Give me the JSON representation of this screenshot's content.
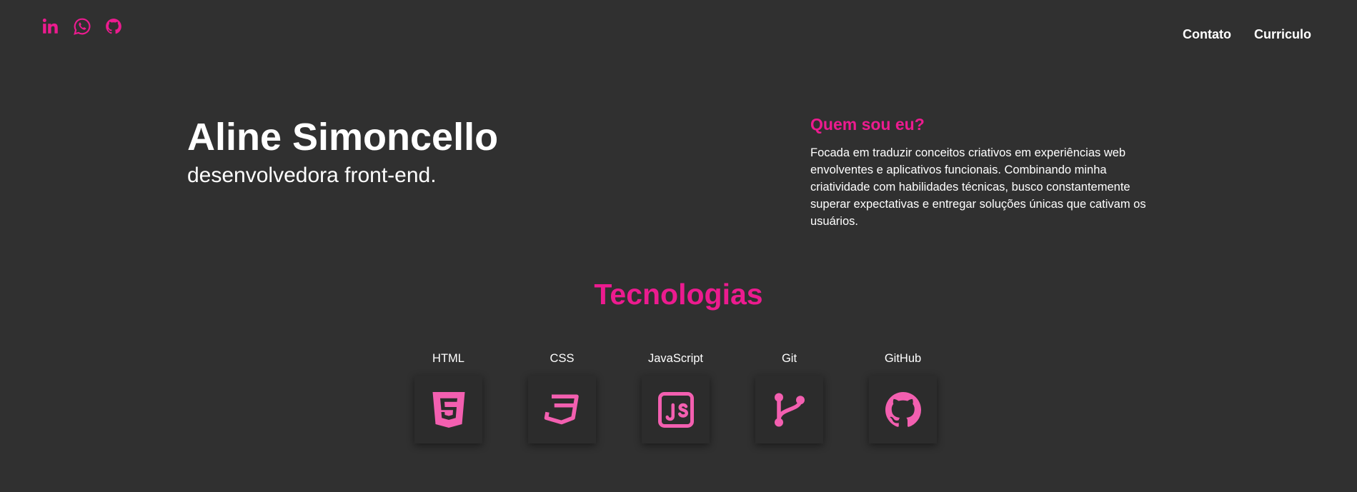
{
  "colors": {
    "accent": "#ec1b8f",
    "icon_pink": "#f35fb0",
    "background": "#303030",
    "text": "#ffffff"
  },
  "social": [
    {
      "icon": "linkedin-icon"
    },
    {
      "icon": "whatsapp-icon"
    },
    {
      "icon": "github-icon"
    }
  ],
  "nav": {
    "contact": "Contato",
    "resume": "Curriculo"
  },
  "hero": {
    "name": "Aline Simoncello",
    "role": "desenvolvedora front-end."
  },
  "about": {
    "title": "Quem sou eu?",
    "text": "Focada em traduzir conceitos criativos em experiências web envolventes e aplicativos funcionais. Combinando minha criatividade com habilidades técnicas, busco constantemente superar expectativas e entregar soluções únicas que cativam os usuários."
  },
  "technologies": {
    "title": "Tecnologias",
    "items": [
      {
        "label": "HTML",
        "icon": "html5-icon"
      },
      {
        "label": "CSS",
        "icon": "css3-icon"
      },
      {
        "label": "JavaScript",
        "icon": "javascript-icon"
      },
      {
        "label": "Git",
        "icon": "git-icon"
      },
      {
        "label": "GitHub",
        "icon": "github-icon"
      }
    ]
  }
}
